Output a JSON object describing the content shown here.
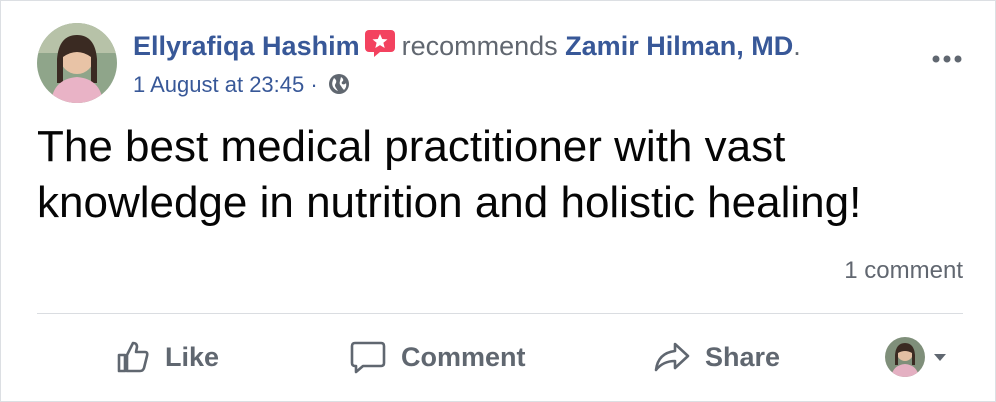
{
  "post": {
    "author": "Ellyrafiqa Hashim",
    "verb": "recommends",
    "target": "Zamir Hilman, MD",
    "target_suffix": ".",
    "timestamp": "1 August at 23:45",
    "separator": "·",
    "privacy_icon": "globe-icon",
    "text": "The best medical practitioner with vast knowledge in nutrition and holistic healing!",
    "comment_count_label": "1 comment"
  },
  "actions": {
    "like": "Like",
    "comment": "Comment",
    "share": "Share"
  },
  "colors": {
    "link": "#385898",
    "muted": "#616770",
    "badge": "#f3425f"
  }
}
